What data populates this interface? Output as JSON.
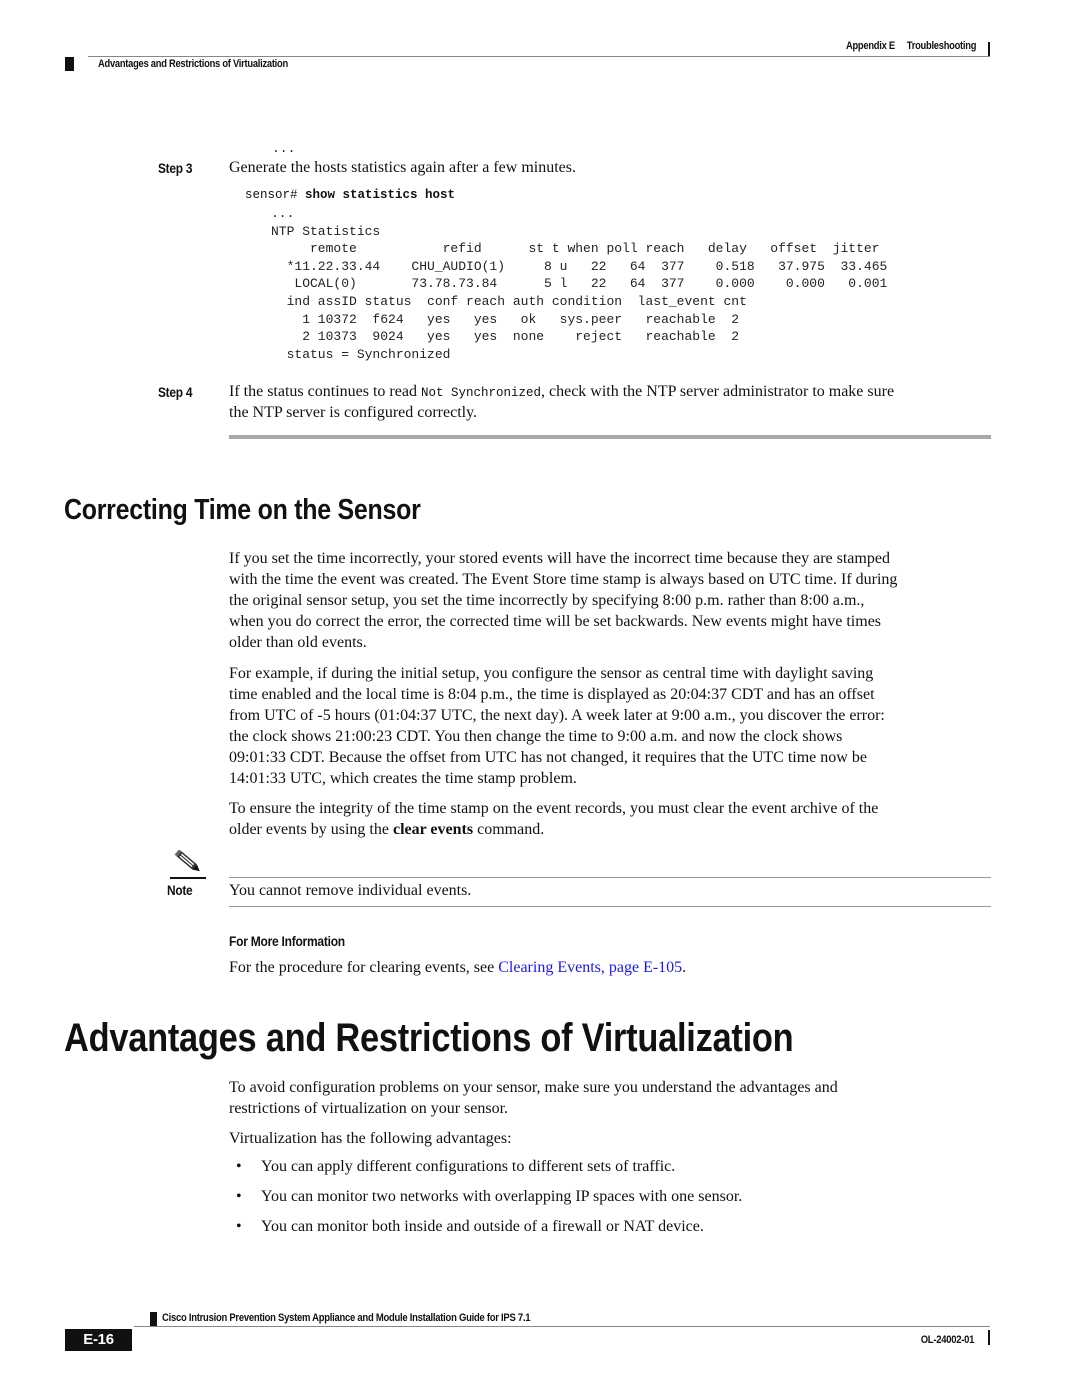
{
  "header": {
    "appendix": "Appendix E",
    "chapter": "Troubleshooting",
    "section": "Advantages and Restrictions of Virtualization"
  },
  "steps": {
    "ellipsis_top": "...",
    "step3": {
      "label": "Step 3",
      "text": "Generate the hosts statistics again after a few minutes.",
      "command_prompt": "sensor# ",
      "command": "show statistics host",
      "output": "...\nNTP Statistics\n     remote           refid      st t when poll reach   delay   offset  jitter\n  *11.22.33.44    CHU_AUDIO(1)     8 u   22   64  377    0.518   37.975  33.465\n   LOCAL(0)       73.78.73.84      5 l   22   64  377    0.000    0.000   0.001\n  ind assID status  conf reach auth condition  last_event cnt\n    1 10372  f624   yes   yes   ok   sys.peer   reachable  2\n    2 10373  9024   yes   yes  none    reject   reachable  2\n  status = Synchronized"
    },
    "step4": {
      "label": "Step 4",
      "text_before": "If the status continues to read ",
      "code": "Not Synchronized",
      "text_after": ", check with the NTP server administrator to make sure",
      "text_line2": "the NTP server is configured correctly."
    }
  },
  "section_correcting": {
    "title": "Correcting Time on the Sensor",
    "paragraphs": [
      [
        "If you set the time incorrectly, your stored events will have the incorrect time because they are stamped",
        "with the time the event was created. The Event Store time stamp is always based on UTC time. If during",
        "the original sensor setup, you set the time incorrectly by specifying 8:00 p.m. rather than 8:00 a.m.,",
        "when you do correct the error, the corrected time will be set backwards. New events might have times",
        "older than old events."
      ],
      [
        "For example, if during the initial setup, you configure the sensor as central time with daylight saving",
        "time enabled and the local time is 8:04 p.m., the time is displayed as 20:04:37 CDT and has an offset",
        "from UTC of -5 hours (01:04:37 UTC, the next day). A week later at 9:00 a.m., you discover the error:",
        "the clock shows 21:00:23 CDT. You then change the time to 9:00 a.m. and now the clock shows",
        "09:01:33 CDT. Because the offset from UTC has not changed, it requires that the UTC time now be",
        "14:01:33 UTC, which creates the time stamp problem."
      ]
    ],
    "para3_line1": "To ensure the integrity of the time stamp on the event records, you must clear the event archive of the",
    "para3_line2_before": "older events by using the ",
    "para3_bold": "clear events",
    "para3_line2_after": " command.",
    "note": {
      "label": "Note",
      "text": "You cannot remove individual events.",
      "icon": "pencil-icon"
    },
    "more_info": {
      "heading": "For More Information",
      "text_before": "For the procedure for clearing events, see ",
      "link": "Clearing Events, page E-105",
      "text_after": "."
    }
  },
  "section_virtualization": {
    "title": "Advantages and Restrictions of Virtualization",
    "intro_lines": [
      "To avoid configuration problems on your sensor, make sure you understand the advantages and",
      "restrictions of virtualization on your sensor."
    ],
    "list_intro": "Virtualization has the following advantages:",
    "bullets": [
      "You can apply different configurations to different sets of traffic.",
      "You can monitor two networks with overlapping IP spaces with one sensor.",
      "You can monitor both inside and outside of a firewall or NAT device."
    ],
    "bullet_glyph": "•"
  },
  "footer": {
    "title": "Cisco Intrusion Prevention System Appliance and Module Installation Guide for IPS 7.1",
    "page": "E-16",
    "doc_number": "OL-24002-01"
  },
  "colors": {
    "link": "#1a1ae6",
    "text": "#111111",
    "rule": "#a8a8a8"
  }
}
